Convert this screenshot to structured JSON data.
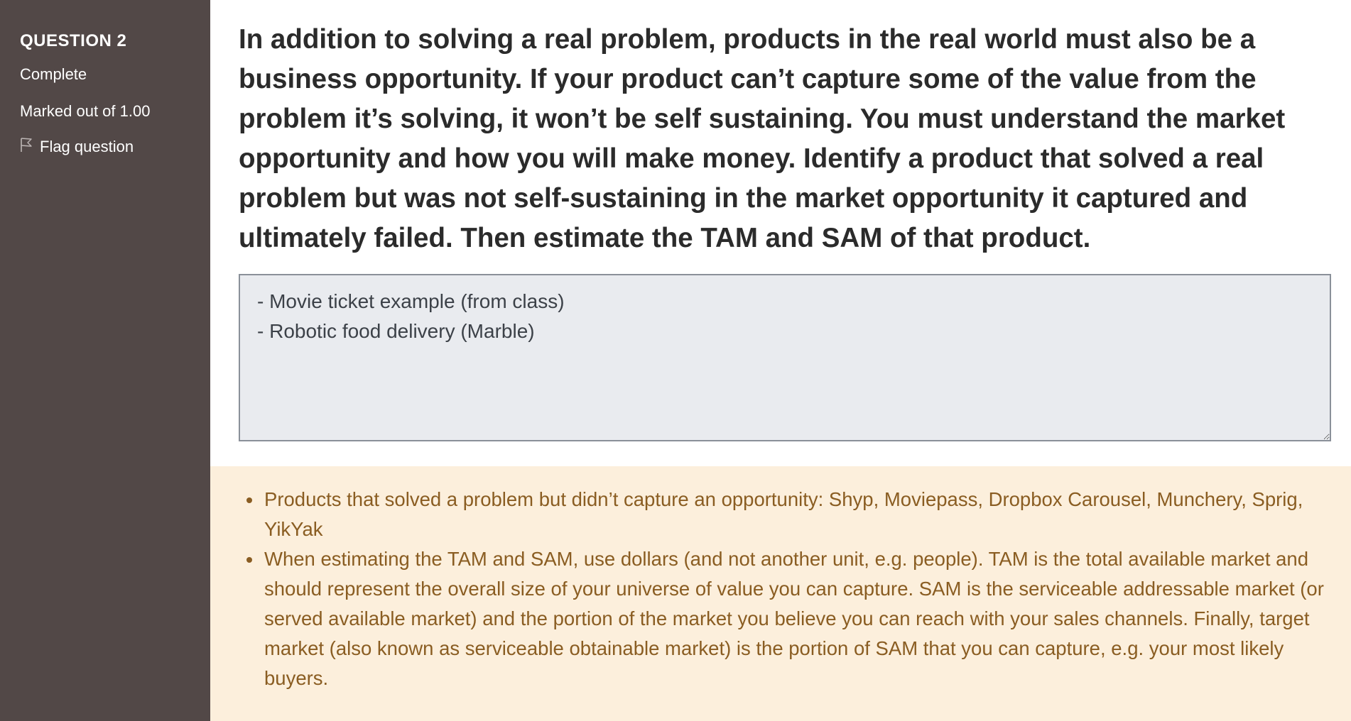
{
  "sidebar": {
    "question_label": "QUESTION",
    "question_number": "2",
    "status": "Complete",
    "marks": "Marked out of 1.00",
    "flag_label": "Flag question",
    "flag_icon": "flag-outline-icon"
  },
  "question": {
    "text": "In addition to solving a real problem, products in the real world must also be a business opportunity. If your product can’t capture some of the value from the problem it’s solving, it won’t be self sustaining. You must understand the market opportunity and how you will make money. Identify a product that solved a real problem but was not self-sustaining in the market opportunity it captured and ultimately failed. Then estimate the TAM and SAM of that product."
  },
  "answer": {
    "value": "- Movie ticket example (from class)\n- Robotic food delivery (Marble)"
  },
  "feedback": {
    "items": [
      "Products that solved a problem but didn’t capture an opportunity: Shyp, Moviepass, Dropbox Carousel, Munchery, Sprig, YikYak",
      "When estimating the TAM and SAM, use dollars (and not another unit, e.g. people). TAM is the total available market and should represent the overall size of your universe of value you can capture. SAM is the serviceable addressable market (or served available market) and the portion of the market you believe you can reach with your sales channels. Finally, target market (also known as serviceable obtainable market) is the portion of SAM that you can capture, e.g. your most likely buyers."
    ]
  },
  "colors": {
    "sidebar_bg": "#524847",
    "feedback_bg": "#fcefdc",
    "feedback_text": "#8a5d22",
    "answer_bg": "#e9ebef"
  }
}
